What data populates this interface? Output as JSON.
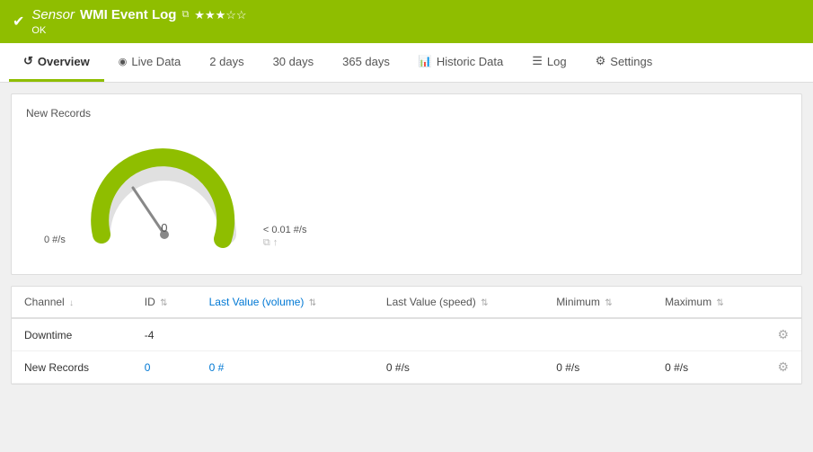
{
  "header": {
    "check": "✔",
    "sensor_label": "Sensor",
    "title": "WMI Event Log",
    "link_icon": "⧉",
    "stars": "★★★☆☆",
    "status": "OK"
  },
  "tabs": [
    {
      "id": "overview",
      "label": "Overview",
      "icon": "↺",
      "active": true
    },
    {
      "id": "live-data",
      "label": "Live Data",
      "icon": "◉",
      "active": false
    },
    {
      "id": "2days",
      "label": "2  days",
      "icon": "",
      "active": false
    },
    {
      "id": "30days",
      "label": "30 days",
      "icon": "",
      "active": false
    },
    {
      "id": "365days",
      "label": "365 days",
      "icon": "",
      "active": false
    },
    {
      "id": "historic-data",
      "label": "Historic Data",
      "icon": "📊",
      "active": false
    },
    {
      "id": "log",
      "label": "Log",
      "icon": "☰",
      "active": false
    },
    {
      "id": "settings",
      "label": "Settings",
      "icon": "⚙",
      "active": false
    }
  ],
  "gauge_card": {
    "title": "New Records",
    "left_label": "0 #/s",
    "center_value": "0",
    "right_value": "< 0.01 #/s",
    "right_icons": "⧉ ↑"
  },
  "table": {
    "columns": [
      {
        "id": "channel",
        "label": "Channel",
        "sort": "↓"
      },
      {
        "id": "id",
        "label": "ID",
        "sort": "⇅"
      },
      {
        "id": "last_value_vol",
        "label": "Last Value (volume)",
        "sort": "⇅"
      },
      {
        "id": "last_value_speed",
        "label": "Last Value (speed)",
        "sort": "⇅"
      },
      {
        "id": "minimum",
        "label": "Minimum",
        "sort": "⇅"
      },
      {
        "id": "maximum",
        "label": "Maximum",
        "sort": "⇅"
      },
      {
        "id": "actions",
        "label": ""
      }
    ],
    "rows": [
      {
        "channel": "Downtime",
        "id": "-4",
        "last_value_vol": "",
        "last_value_speed": "",
        "minimum": "",
        "maximum": "",
        "gear": "⚙"
      },
      {
        "channel": "New Records",
        "id": "0",
        "last_value_vol": "0 #",
        "last_value_speed": "0 #/s",
        "minimum": "0 #/s",
        "maximum": "0 #/s",
        "gear": "⚙"
      }
    ]
  },
  "colors": {
    "accent": "#8fbe00",
    "header_bg": "#8fbe00",
    "link_blue": "#0078d4"
  }
}
